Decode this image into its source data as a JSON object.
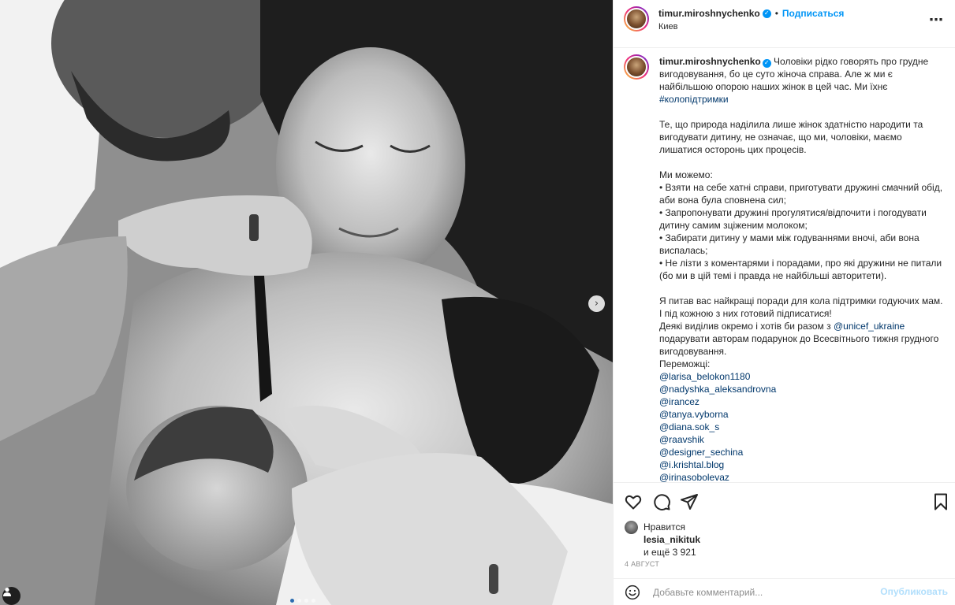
{
  "post": {
    "username": "timur.miroshnychenko",
    "follow_label": "Подписаться",
    "separator": "•",
    "location": "Киев",
    "more_icon": "more-horizontal-icon",
    "caption_text": "Чоловіки рідко говорять про грудне вигодовування, бо це суто жіноча справа. Але ж ми є найбільшою опорою наших жінок в цей час. Ми їхнє ",
    "hashtag": "#колопідтримки",
    "caption_p2": "\n\nТе, що природа наділила лише жінок здатністю народити та вигодувати дитину, не означає, що ми, чоловіки, маємо лишатися осторонь цих процесів.\n\nМи можемо:\n• Взяти на себе хатні справи, приготувати дружині смачний обід, аби вона була сповнена сил;\n• Запропонувати дружині прогулятися/відпочити і погодувати дитину самим зціженим молоком;\n• Забирати дитину у мами між годуваннями вночі, аби вона виспалась;\n• Не лізти з коментарями і порадами, про які дружини не питали (бо ми в цій темі і правда не найбільші авторитети).\n\nЯ питав вас найкращі поради для кола підтримки годуючих мам. І під кожною з них готовий підписатися!\nДеякі виділив окремо і хотів би разом з ",
    "mention_unicef": "@unicef_ukraine",
    "caption_p3": " подарувати авторам подарунок до Всесвітнього тижня грудного вигодовування.\nПереможці:",
    "winners": [
      "@larisa_belokon1180",
      "@nadyshka_aleksandrovna",
      "@irancez",
      "@tanya.vyborna",
      "@diana.sok_s",
      "@raavshik",
      "@designer_sechina",
      "@i.krishtal.blog",
      "@irinasobolevaz"
    ]
  },
  "likes": {
    "line1": "Нравится",
    "user": "lesia_nikituk",
    "line3": "и ещё 3 921"
  },
  "date": "4 АВГУСТ",
  "comment_box": {
    "placeholder": "Добавьте комментарий...",
    "publish_label": "Опубликовать"
  },
  "carousel": {
    "count": 4,
    "active_index": 0
  },
  "colors": {
    "accent": "#0095f6",
    "link": "#00376b",
    "publish_disabled": "#b2dffc"
  }
}
